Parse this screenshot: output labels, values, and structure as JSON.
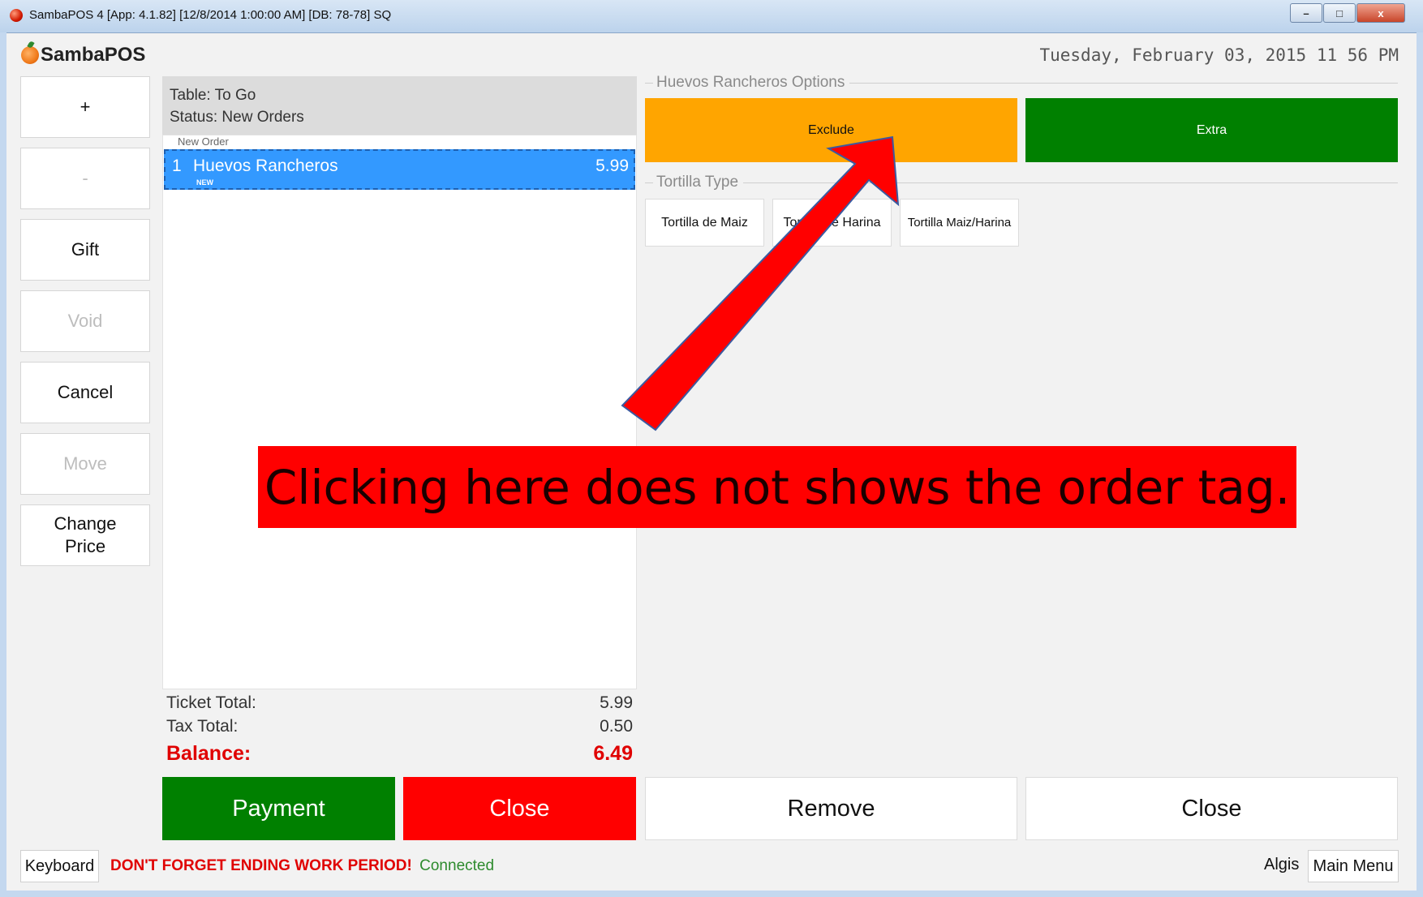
{
  "window": {
    "title": "SambaPOS 4 [App: 4.1.82] [12/8/2014 1:00:00 AM] [DB: 78-78] SQ",
    "controls": {
      "minimize": "–",
      "maximize": "□",
      "close": "x"
    }
  },
  "header": {
    "logo_text": "SambaPOS",
    "datetime": "Tuesday, February 03, 2015 11 56 PM"
  },
  "commands": {
    "plus": "+",
    "minus": "-",
    "gift": "Gift",
    "void": "Void",
    "cancel": "Cancel",
    "move": "Move",
    "change_price": "Change Price"
  },
  "ticket": {
    "table": "Table: To Go",
    "status": "Status: New Orders",
    "new_order_label": "New Order",
    "orders": [
      {
        "qty": "1",
        "name": "Huevos Rancheros",
        "price": "5.99",
        "badge": "NEW"
      }
    ],
    "totals": {
      "ticket_total_label": "Ticket Total:",
      "ticket_total": "5.99",
      "tax_total_label": "Tax Total:",
      "tax_total": "0.50",
      "balance_label": "Balance:",
      "balance": "6.49"
    }
  },
  "options": {
    "group1_title": "Huevos Rancheros Options",
    "exclude": "Exclude",
    "extra": "Extra",
    "group2_title": "Tortilla Type",
    "tortillas": [
      "Tortilla de Maiz",
      "Tortilla de Harina",
      "Tortilla Maiz/Harina"
    ]
  },
  "actions": {
    "payment": "Payment",
    "close_red": "Close",
    "remove": "Remove",
    "close_white": "Close"
  },
  "status_bar": {
    "keyboard": "Keyboard",
    "warning": "DON'T FORGET ENDING WORK PERIOD!",
    "connection": "Connected",
    "user": "Algis",
    "main_menu": "Main Menu"
  },
  "annotation": {
    "text": "Clicking here does not shows the order tag."
  },
  "colors": {
    "payment": "#008000",
    "close": "#ff0000",
    "exclude": "#ffa500",
    "extra": "#008000",
    "selected_order": "#3399ff",
    "balance": "#e00000"
  }
}
